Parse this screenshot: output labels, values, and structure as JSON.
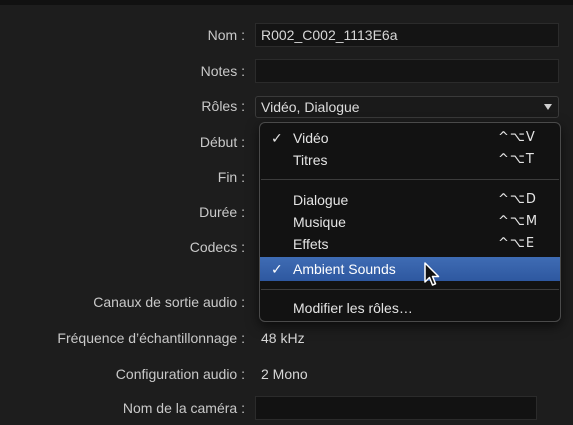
{
  "fields": {
    "name": {
      "label": "Nom :",
      "value": "R002_C002_1113E6a"
    },
    "notes": {
      "label": "Notes :",
      "value": ""
    },
    "roles": {
      "label": "Rôles :",
      "value": "Vidéo, Dialogue"
    },
    "start": {
      "label": "Début :"
    },
    "end": {
      "label": "Fin :"
    },
    "duration": {
      "label": "Durée :"
    },
    "codecs": {
      "label": "Codecs :"
    },
    "audio_channels": {
      "label": "Canaux de sortie audio :"
    },
    "sample_rate": {
      "label": "Fréquence d’échantillonnage :",
      "value": "48 kHz"
    },
    "audio_config": {
      "label": "Configuration audio :",
      "value": "2 Mono"
    },
    "camera_name": {
      "label": "Nom de la caméra :",
      "value": ""
    }
  },
  "roles_menu": {
    "items": [
      {
        "label": "Vidéo",
        "checked": "✓",
        "shortcut": "^⌥V"
      },
      {
        "label": "Titres",
        "checked": "",
        "shortcut": "^⌥T"
      },
      {
        "label": "Dialogue",
        "checked": "",
        "shortcut": "^⌥D"
      },
      {
        "label": "Musique",
        "checked": "",
        "shortcut": "^⌥M"
      },
      {
        "label": "Effets",
        "checked": "",
        "shortcut": "^⌥E"
      },
      {
        "label": "Ambient Sounds",
        "checked": "✓",
        "shortcut": "",
        "highlighted": true
      },
      {
        "label": "Modifier les rôles…",
        "checked": "",
        "shortcut": ""
      }
    ]
  },
  "icons": {
    "caret": "chevron-down-icon",
    "checkmark": "checkmark-icon",
    "pointer": "pointer-cursor-icon"
  }
}
